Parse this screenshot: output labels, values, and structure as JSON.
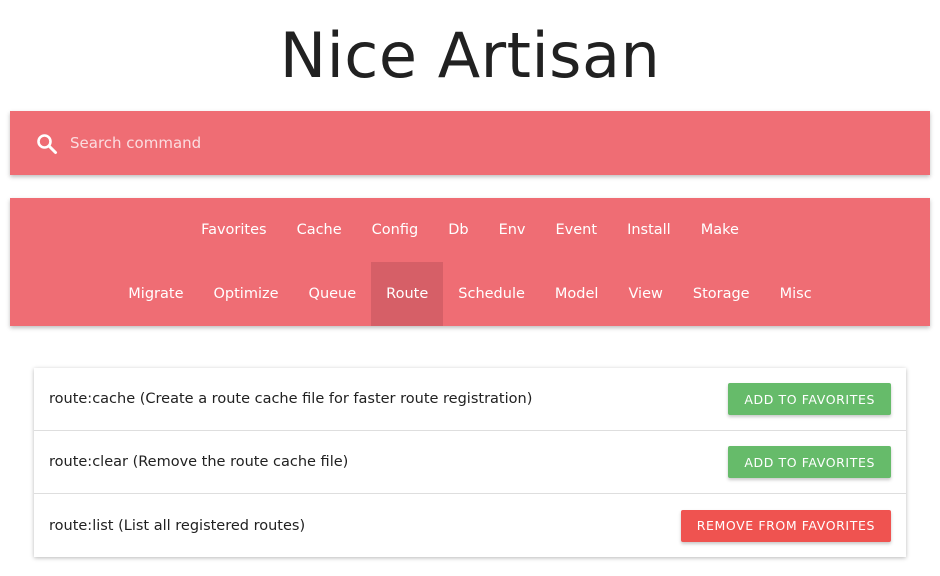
{
  "app": {
    "title": "Nice Artisan"
  },
  "search": {
    "icon": "search-icon",
    "placeholder": "Search command",
    "value": ""
  },
  "nav": {
    "row1": [
      {
        "label": "Favorites",
        "active": false
      },
      {
        "label": "Cache",
        "active": false
      },
      {
        "label": "Config",
        "active": false
      },
      {
        "label": "Db",
        "active": false
      },
      {
        "label": "Env",
        "active": false
      },
      {
        "label": "Event",
        "active": false
      },
      {
        "label": "Install",
        "active": false
      },
      {
        "label": "Make",
        "active": false
      }
    ],
    "row2": [
      {
        "label": "Migrate",
        "active": false
      },
      {
        "label": "Optimize",
        "active": false
      },
      {
        "label": "Queue",
        "active": false
      },
      {
        "label": "Route",
        "active": true
      },
      {
        "label": "Schedule",
        "active": false
      },
      {
        "label": "Model",
        "active": false
      },
      {
        "label": "View",
        "active": false
      },
      {
        "label": "Storage",
        "active": false
      },
      {
        "label": "Misc",
        "active": false
      }
    ]
  },
  "commands": [
    {
      "text": "route:cache (Create a route cache file for faster route registration)",
      "button": "ADD TO FAVORITES",
      "favorite": false
    },
    {
      "text": "route:clear (Remove the route cache file)",
      "button": "ADD TO FAVORITES",
      "favorite": false
    },
    {
      "text": "route:list (List all registered routes)",
      "button": "REMOVE FROM FAVORITES",
      "favorite": true
    }
  ],
  "colors": {
    "primary": "#ef6d74",
    "primary_active": "#d65f67",
    "add_button": "#66bb6a",
    "remove_button": "#ef5350"
  }
}
